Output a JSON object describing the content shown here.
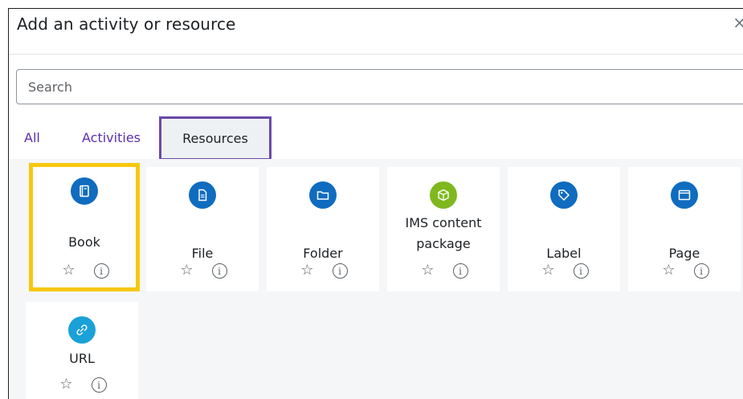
{
  "dialog": {
    "title": "Add an activity or resource",
    "close_symbol": "×"
  },
  "search": {
    "placeholder": "Search",
    "value": ""
  },
  "tabs": [
    {
      "label": "All",
      "selected": false
    },
    {
      "label": "Activities",
      "selected": false
    },
    {
      "label": "Resources",
      "selected": true
    }
  ],
  "colors": {
    "blue_icon": "#0f6cbf",
    "green_icon": "#7fb81e",
    "cyan_icon": "#1aa1d8",
    "highlight_box": "#f7c80f",
    "selected_tab_outline": "#6b49a8",
    "tab_link": "#5b2fb0"
  },
  "items": [
    {
      "label": "Book",
      "icon": "book-icon",
      "color": "#0f6cbf",
      "highlighted": true
    },
    {
      "label": "File",
      "icon": "file-icon",
      "color": "#0f6cbf"
    },
    {
      "label": "Folder",
      "icon": "folder-icon",
      "color": "#0f6cbf"
    },
    {
      "label": "IMS content package",
      "label_line1": "IMS content",
      "label_line2": "package",
      "icon": "package-icon",
      "color": "#7fb81e"
    },
    {
      "label": "Label",
      "icon": "tag-icon",
      "color": "#0f6cbf"
    },
    {
      "label": "Page",
      "icon": "page-icon",
      "color": "#0f6cbf"
    },
    {
      "label": "URL",
      "icon": "link-icon",
      "color": "#1aa1d8"
    }
  ],
  "action_icons": {
    "star": "☆",
    "info": "i"
  }
}
